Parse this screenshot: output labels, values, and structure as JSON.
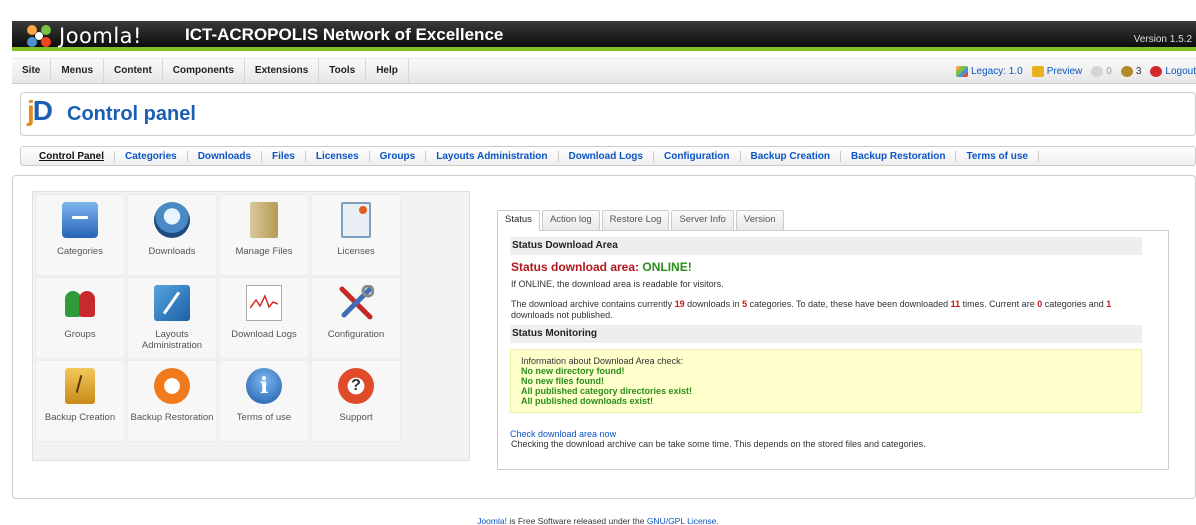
{
  "header": {
    "logo_text": "Joomla!",
    "site_title": "ICT-ACROPOLIS Network of Excellence",
    "version": "Version 1.5.2"
  },
  "menu": {
    "items": [
      "Site",
      "Menus",
      "Content",
      "Components",
      "Extensions",
      "Tools",
      "Help"
    ],
    "status": {
      "legacy": "Legacy: 1.0",
      "preview": "Preview",
      "messages": "0",
      "users": "3",
      "logout": "Logout"
    }
  },
  "title": {
    "logo_j": "j",
    "logo_d": "D",
    "text": "Control panel"
  },
  "submenu": {
    "items": [
      "Control Panel",
      "Categories",
      "Downloads",
      "Files",
      "Licenses",
      "Groups",
      "Layouts Administration",
      "Download Logs",
      "Configuration",
      "Backup Creation",
      "Backup Restoration",
      "Terms of use"
    ]
  },
  "icons": [
    {
      "label": "Categories",
      "icon": "categories-icon"
    },
    {
      "label": "Downloads",
      "icon": "downloads-icon"
    },
    {
      "label": "Manage Files",
      "icon": "files-icon"
    },
    {
      "label": "Licenses",
      "icon": "licenses-icon"
    },
    {
      "label": "Groups",
      "icon": "groups-icon"
    },
    {
      "label": "Layouts Administration",
      "icon": "layouts-icon"
    },
    {
      "label": "Download Logs",
      "icon": "logs-icon"
    },
    {
      "label": "Configuration",
      "icon": "configuration-icon"
    },
    {
      "label": "Backup Creation",
      "icon": "backup-icon"
    },
    {
      "label": "Backup Restoration",
      "icon": "restore-icon"
    },
    {
      "label": "Terms of use",
      "icon": "terms-icon"
    },
    {
      "label": "Support",
      "icon": "support-icon"
    }
  ],
  "tabs": [
    "Status",
    "Action log",
    "Restore Log",
    "Server Info",
    "Version"
  ],
  "status": {
    "section1_title": "Status Download Area",
    "big_label": "Status download area:",
    "big_value": "ONLINE!",
    "online_note": "If ONLINE, the download area is readable for visitors.",
    "archive": {
      "t1": "The download archive contains currently ",
      "downloads": "19",
      "t2": " downloads in ",
      "categories": "5",
      "t3": " categories. To date, these have been downloaded ",
      "times": "11",
      "t4": " times. Current are ",
      "unpub_cats": "0",
      "t5": " categories and ",
      "unpub_dls": "1",
      "t6": " downloads not published."
    },
    "section2_title": "Status Monitoring",
    "monitor_intro": "Information about Download Area check:",
    "monitor_lines": [
      "No new directory found!",
      "No new files found!",
      "All published category directories exist!",
      "All published downloads exist!"
    ],
    "check_link": "Check download area now",
    "check_note": "Checking the download archive can be take some time. This depends on the stored files and categories."
  },
  "footer": {
    "joomla": "Joomla!",
    "middle": " is Free Software released under the ",
    "license": "GNU/GPL License",
    "end": "."
  },
  "colors": {
    "header_accent": "#7fbf25",
    "link": "#0b55c4",
    "error_red": "#b3161b",
    "ok_green": "#2a8f1c"
  }
}
